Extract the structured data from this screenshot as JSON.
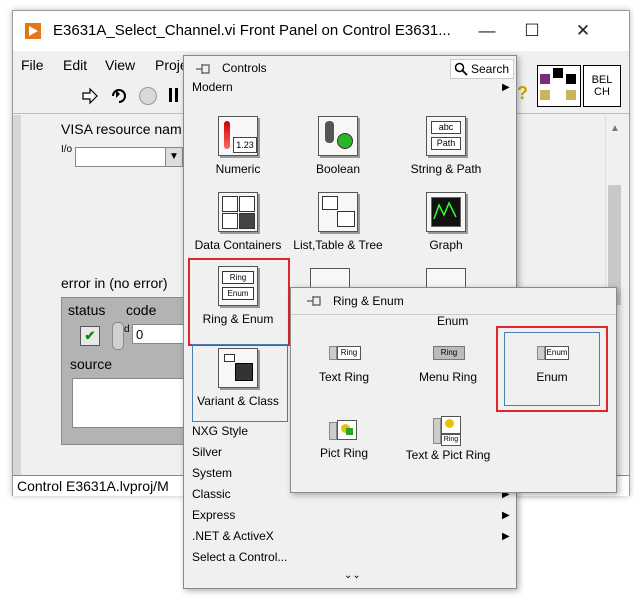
{
  "window": {
    "title": "E3631A_Select_Channel.vi Front Panel on Control E3631...",
    "minimize_glyph": "—",
    "maximize_glyph": "☐",
    "close_glyph": "✕"
  },
  "menubar": {
    "items": [
      "File",
      "Edit",
      "View",
      "Proje"
    ]
  },
  "toolbar": {
    "help_glyph": "?",
    "vi_icon_text_line1": "BEL",
    "vi_icon_text_line2": "CH"
  },
  "front_panel": {
    "visa_label": "VISA resource nam",
    "visa_prefix": "I/o",
    "error_cluster_label": "error in (no error)",
    "status_label": "status",
    "code_label": "code",
    "code_value": "0",
    "code_prefix": "d",
    "source_label": "source"
  },
  "statusbar": {
    "text": "Control E3631A.lvproj/M"
  },
  "palette": {
    "title": "Controls",
    "search_label": "Search",
    "modern_label": "Modern",
    "items": [
      {
        "label": "Numeric",
        "icon": "numeric-icon"
      },
      {
        "label": "Boolean",
        "icon": "boolean-icon"
      },
      {
        "label": "String & Path",
        "icon": "string-path-icon"
      },
      {
        "label": "Data Containers",
        "icon": "data-containers-icon"
      },
      {
        "label": "List,Table & Tree",
        "icon": "list-table-tree-icon"
      },
      {
        "label": "Graph",
        "icon": "graph-icon"
      },
      {
        "label": "Ring & Enum",
        "icon": "ring-enum-icon"
      },
      {
        "label": "Variant & Class",
        "icon": "variant-class-icon"
      }
    ],
    "numeric_icon_text": "1.23",
    "string_icon_text_1": "abc",
    "string_icon_text_2": "Path",
    "ring_icon_text_1": "Ring",
    "ring_icon_text_2": "Enum",
    "categories": [
      "NXG Style",
      "Silver",
      "System",
      "Classic",
      "Express",
      ".NET & ActiveX",
      "Select a Control..."
    ],
    "more_glyph": "⌄⌄"
  },
  "subpalette": {
    "title": "Ring & Enum",
    "header_label": "Enum",
    "items": [
      {
        "label": "Text Ring",
        "icon": "text-ring-icon",
        "mini": "Ring"
      },
      {
        "label": "Menu Ring",
        "icon": "menu-ring-icon",
        "mini": "Ring"
      },
      {
        "label": "Enum",
        "icon": "enum-icon",
        "mini": "Enum"
      },
      {
        "label": "Pict Ring",
        "icon": "pict-ring-icon",
        "mini": ""
      },
      {
        "label": "Text & Pict Ring",
        "icon": "text-pict-ring-icon",
        "mini": "Ring"
      }
    ]
  },
  "colors": {
    "highlight_border": "#e0242c",
    "title_accent": "#e2761a"
  }
}
